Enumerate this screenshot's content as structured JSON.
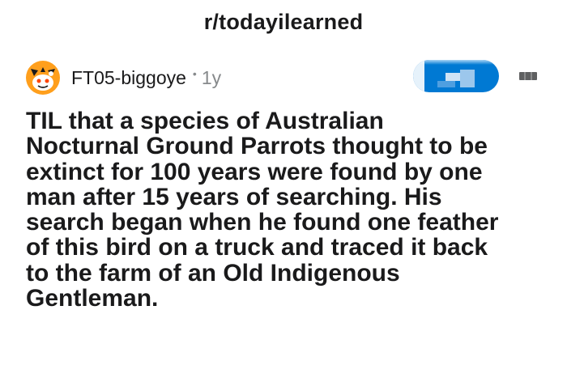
{
  "header": {
    "subreddit": "r/todayilearned"
  },
  "post": {
    "author": "FT05-biggoye",
    "separator": "•",
    "age": "1y",
    "title_lines": [
      "TIL that a species of Australian",
      "Nocturnal Ground Parrots thought to be",
      "extinct for 100 years were found by one",
      "man after 15 years of searching. His",
      "search began when he found one feather",
      "of this bird on a truck and traced it back",
      "to the farm of an Old Indigenous",
      "Gentleman."
    ]
  },
  "icons": {
    "avatar": "snoo-avatar-icon",
    "more": "more-options-icon"
  },
  "colors": {
    "text": "#1a1a1b",
    "meta": "#878a8c",
    "accent": "#0079d3",
    "avatar_orange": "#ff9f1c"
  }
}
